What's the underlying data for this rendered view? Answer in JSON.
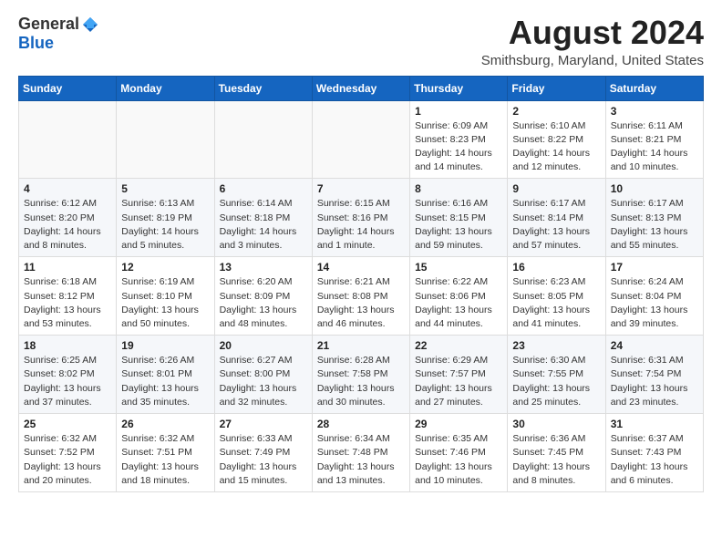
{
  "header": {
    "logo_general": "General",
    "logo_blue": "Blue",
    "month_year": "August 2024",
    "location": "Smithsburg, Maryland, United States"
  },
  "days_of_week": [
    "Sunday",
    "Monday",
    "Tuesday",
    "Wednesday",
    "Thursday",
    "Friday",
    "Saturday"
  ],
  "weeks": [
    [
      {
        "num": "",
        "info": ""
      },
      {
        "num": "",
        "info": ""
      },
      {
        "num": "",
        "info": ""
      },
      {
        "num": "",
        "info": ""
      },
      {
        "num": "1",
        "info": "Sunrise: 6:09 AM\nSunset: 8:23 PM\nDaylight: 14 hours\nand 14 minutes."
      },
      {
        "num": "2",
        "info": "Sunrise: 6:10 AM\nSunset: 8:22 PM\nDaylight: 14 hours\nand 12 minutes."
      },
      {
        "num": "3",
        "info": "Sunrise: 6:11 AM\nSunset: 8:21 PM\nDaylight: 14 hours\nand 10 minutes."
      }
    ],
    [
      {
        "num": "4",
        "info": "Sunrise: 6:12 AM\nSunset: 8:20 PM\nDaylight: 14 hours\nand 8 minutes."
      },
      {
        "num": "5",
        "info": "Sunrise: 6:13 AM\nSunset: 8:19 PM\nDaylight: 14 hours\nand 5 minutes."
      },
      {
        "num": "6",
        "info": "Sunrise: 6:14 AM\nSunset: 8:18 PM\nDaylight: 14 hours\nand 3 minutes."
      },
      {
        "num": "7",
        "info": "Sunrise: 6:15 AM\nSunset: 8:16 PM\nDaylight: 14 hours\nand 1 minute."
      },
      {
        "num": "8",
        "info": "Sunrise: 6:16 AM\nSunset: 8:15 PM\nDaylight: 13 hours\nand 59 minutes."
      },
      {
        "num": "9",
        "info": "Sunrise: 6:17 AM\nSunset: 8:14 PM\nDaylight: 13 hours\nand 57 minutes."
      },
      {
        "num": "10",
        "info": "Sunrise: 6:17 AM\nSunset: 8:13 PM\nDaylight: 13 hours\nand 55 minutes."
      }
    ],
    [
      {
        "num": "11",
        "info": "Sunrise: 6:18 AM\nSunset: 8:12 PM\nDaylight: 13 hours\nand 53 minutes."
      },
      {
        "num": "12",
        "info": "Sunrise: 6:19 AM\nSunset: 8:10 PM\nDaylight: 13 hours\nand 50 minutes."
      },
      {
        "num": "13",
        "info": "Sunrise: 6:20 AM\nSunset: 8:09 PM\nDaylight: 13 hours\nand 48 minutes."
      },
      {
        "num": "14",
        "info": "Sunrise: 6:21 AM\nSunset: 8:08 PM\nDaylight: 13 hours\nand 46 minutes."
      },
      {
        "num": "15",
        "info": "Sunrise: 6:22 AM\nSunset: 8:06 PM\nDaylight: 13 hours\nand 44 minutes."
      },
      {
        "num": "16",
        "info": "Sunrise: 6:23 AM\nSunset: 8:05 PM\nDaylight: 13 hours\nand 41 minutes."
      },
      {
        "num": "17",
        "info": "Sunrise: 6:24 AM\nSunset: 8:04 PM\nDaylight: 13 hours\nand 39 minutes."
      }
    ],
    [
      {
        "num": "18",
        "info": "Sunrise: 6:25 AM\nSunset: 8:02 PM\nDaylight: 13 hours\nand 37 minutes."
      },
      {
        "num": "19",
        "info": "Sunrise: 6:26 AM\nSunset: 8:01 PM\nDaylight: 13 hours\nand 35 minutes."
      },
      {
        "num": "20",
        "info": "Sunrise: 6:27 AM\nSunset: 8:00 PM\nDaylight: 13 hours\nand 32 minutes."
      },
      {
        "num": "21",
        "info": "Sunrise: 6:28 AM\nSunset: 7:58 PM\nDaylight: 13 hours\nand 30 minutes."
      },
      {
        "num": "22",
        "info": "Sunrise: 6:29 AM\nSunset: 7:57 PM\nDaylight: 13 hours\nand 27 minutes."
      },
      {
        "num": "23",
        "info": "Sunrise: 6:30 AM\nSunset: 7:55 PM\nDaylight: 13 hours\nand 25 minutes."
      },
      {
        "num": "24",
        "info": "Sunrise: 6:31 AM\nSunset: 7:54 PM\nDaylight: 13 hours\nand 23 minutes."
      }
    ],
    [
      {
        "num": "25",
        "info": "Sunrise: 6:32 AM\nSunset: 7:52 PM\nDaylight: 13 hours\nand 20 minutes."
      },
      {
        "num": "26",
        "info": "Sunrise: 6:32 AM\nSunset: 7:51 PM\nDaylight: 13 hours\nand 18 minutes."
      },
      {
        "num": "27",
        "info": "Sunrise: 6:33 AM\nSunset: 7:49 PM\nDaylight: 13 hours\nand 15 minutes."
      },
      {
        "num": "28",
        "info": "Sunrise: 6:34 AM\nSunset: 7:48 PM\nDaylight: 13 hours\nand 13 minutes."
      },
      {
        "num": "29",
        "info": "Sunrise: 6:35 AM\nSunset: 7:46 PM\nDaylight: 13 hours\nand 10 minutes."
      },
      {
        "num": "30",
        "info": "Sunrise: 6:36 AM\nSunset: 7:45 PM\nDaylight: 13 hours\nand 8 minutes."
      },
      {
        "num": "31",
        "info": "Sunrise: 6:37 AM\nSunset: 7:43 PM\nDaylight: 13 hours\nand 6 minutes."
      }
    ]
  ]
}
